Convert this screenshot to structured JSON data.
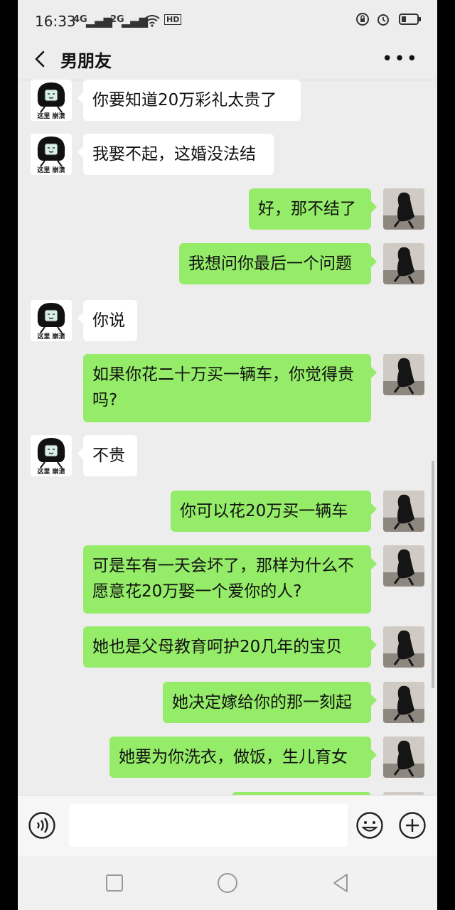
{
  "status": {
    "time": "16:33",
    "signal1": "4G",
    "signal2": "2G",
    "hd": "HD"
  },
  "header": {
    "title": "男朋友"
  },
  "avatar_caption": "这里 崩溃",
  "messages": [
    {
      "side": "left",
      "text": "你要知道20万彩礼太贵了"
    },
    {
      "side": "left",
      "text": "我娶不起，这婚没法结"
    },
    {
      "side": "right",
      "text": "好，那不结了"
    },
    {
      "side": "right",
      "text": "我想问你最后一个问题"
    },
    {
      "side": "left",
      "text": "你说"
    },
    {
      "side": "right",
      "text": "如果你花二十万买一辆车，你觉得贵\n吗?"
    },
    {
      "side": "left",
      "text": "不贵"
    },
    {
      "side": "right",
      "text": "你可以花20万买一辆车"
    },
    {
      "side": "right",
      "text": "可是车有一天会坏了，那样为什么不\n愿意花20万娶一个爱你的人?"
    },
    {
      "side": "right",
      "text": "她也是父母教育呵护20几年的宝贝"
    },
    {
      "side": "right",
      "text": "她决定嫁给你的那一刻起"
    },
    {
      "side": "right",
      "text": "她要为你洗衣，做饭，生儿育女"
    },
    {
      "side": "right",
      "text": ""
    }
  ],
  "input": {
    "placeholder": ""
  },
  "icons": {
    "back": "back-arrow-icon",
    "more": "more-icon",
    "voice": "voice-icon",
    "emoji": "emoji-icon",
    "plus": "plus-icon"
  },
  "colors": {
    "bubble_self": "#95ec69",
    "bubble_other": "#ffffff",
    "background": "#ededed"
  }
}
